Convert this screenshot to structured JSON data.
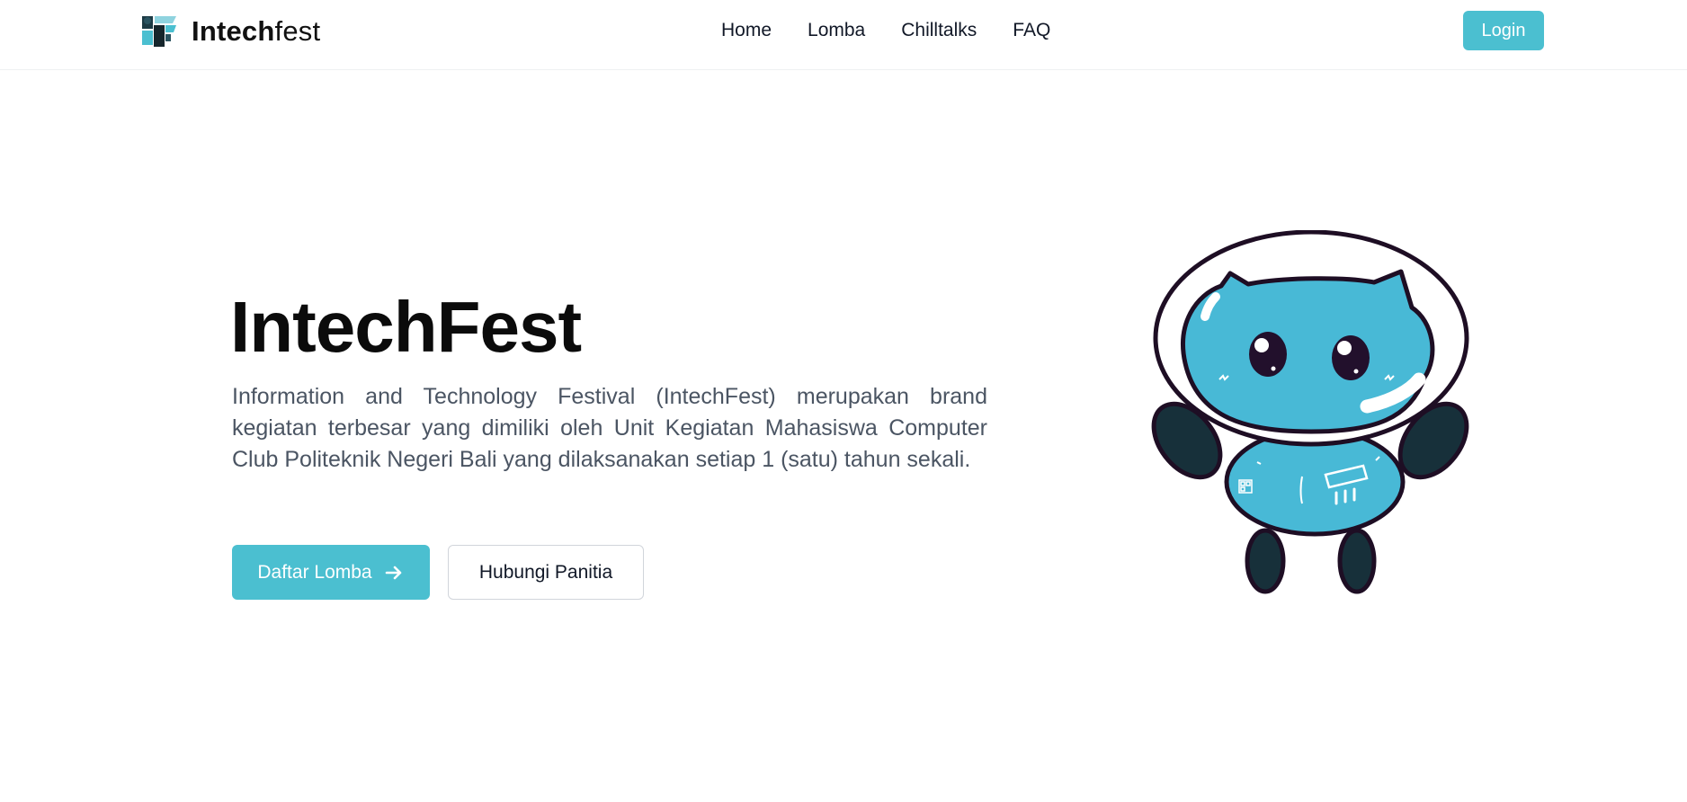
{
  "brand": {
    "name_bold": "Intech",
    "name_light": "fest",
    "logo_icon": "intechfest-logo-icon"
  },
  "nav": {
    "items": [
      "Home",
      "Lomba",
      "Chilltalks",
      "FAQ"
    ]
  },
  "header": {
    "login_label": "Login"
  },
  "hero": {
    "title": "IntechFest",
    "description": "Information and Technology Festival (IntechFest) merupakan brand kegiatan terbesar yang dimiliki oleh Unit Kegiatan Mahasiswa Computer Club Politeknik Negeri Bali yang dilaksanakan setiap 1 (satu) tahun sekali.",
    "primary_button": "Daftar Lomba",
    "secondary_button": "Hubungi Panitia",
    "primary_icon": "arrow-right-icon",
    "illustration": "astronaut-cat-mascot"
  },
  "colors": {
    "accent": "#4bbfd0",
    "mascot_body": "#48b9d6",
    "mascot_limbs": "#17303a",
    "outline": "#1e0e24"
  }
}
